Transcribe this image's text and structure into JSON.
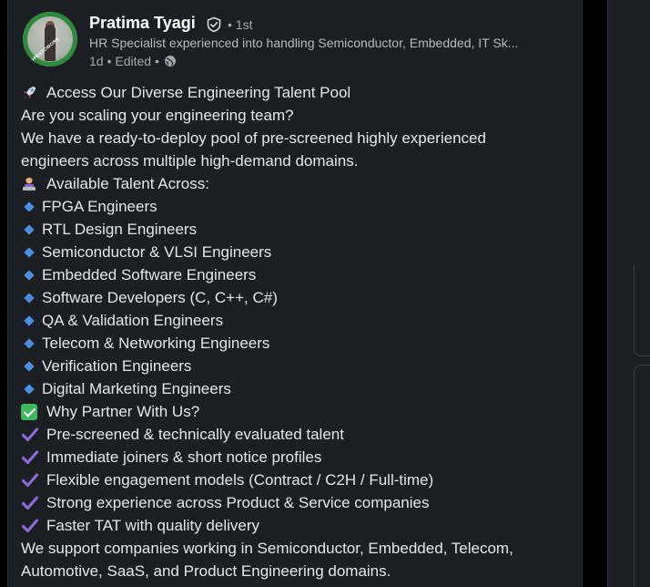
{
  "post": {
    "author_name": "Pratima Tyagi",
    "degree": "• 1st",
    "headline": "HR Specialist experienced into handling Semiconductor, Embedded, IT Sk...",
    "time": "1d",
    "edited": "• Edited •",
    "avatar_badge_text": "#OPENTOWORK"
  },
  "content": {
    "intro_title": "Access Our Diverse Engineering Talent Pool",
    "intro_question": "Are you scaling your engineering team?",
    "intro_line1": "We have a ready-to-deploy pool of pre-screened highly experienced",
    "intro_line2": "engineers across multiple high-demand domains.",
    "talent_heading": "Available Talent Across:",
    "talent_items": [
      "FPGA Engineers",
      "RTL Design Engineers",
      "Semiconductor & VLSI Engineers",
      "Embedded Software Engineers",
      "Software Developers (C, C++, C#)",
      "QA & Validation Engineers",
      "Telecom & Networking Engineers",
      "Verification Engineers",
      "Digital Marketing Engineers"
    ],
    "partner_heading": "Why Partner With Us?",
    "partner_items": [
      "Pre-screened & technically evaluated talent",
      "Immediate joiners & short notice profiles",
      "Flexible engagement models (Contract / C2H / Full-time)",
      "Strong experience across Product & Service companies",
      "Faster TAT with quality delivery"
    ],
    "closing_line1": "We support companies working in Semiconductor, Embedded, Telecom,",
    "closing_line2": "Automotive, SaaS, and Product Engineering domains."
  },
  "icons": {
    "rocket": "rocket-icon",
    "technologist": "technologist-icon",
    "bullet": "blue-diamond-icon",
    "check_box": "green-check-box-icon",
    "check_mark": "purple-check-mark-icon",
    "verified": "verified-shield-icon",
    "globe": "globe-icon"
  },
  "colors": {
    "background": "#000000",
    "card": "#1b1f23",
    "diamond_blue": "#4a8fe0",
    "check_purple": "#8a6ad8",
    "check_green": "#3db85a",
    "open_to_work_green": "#2c8a3a"
  }
}
